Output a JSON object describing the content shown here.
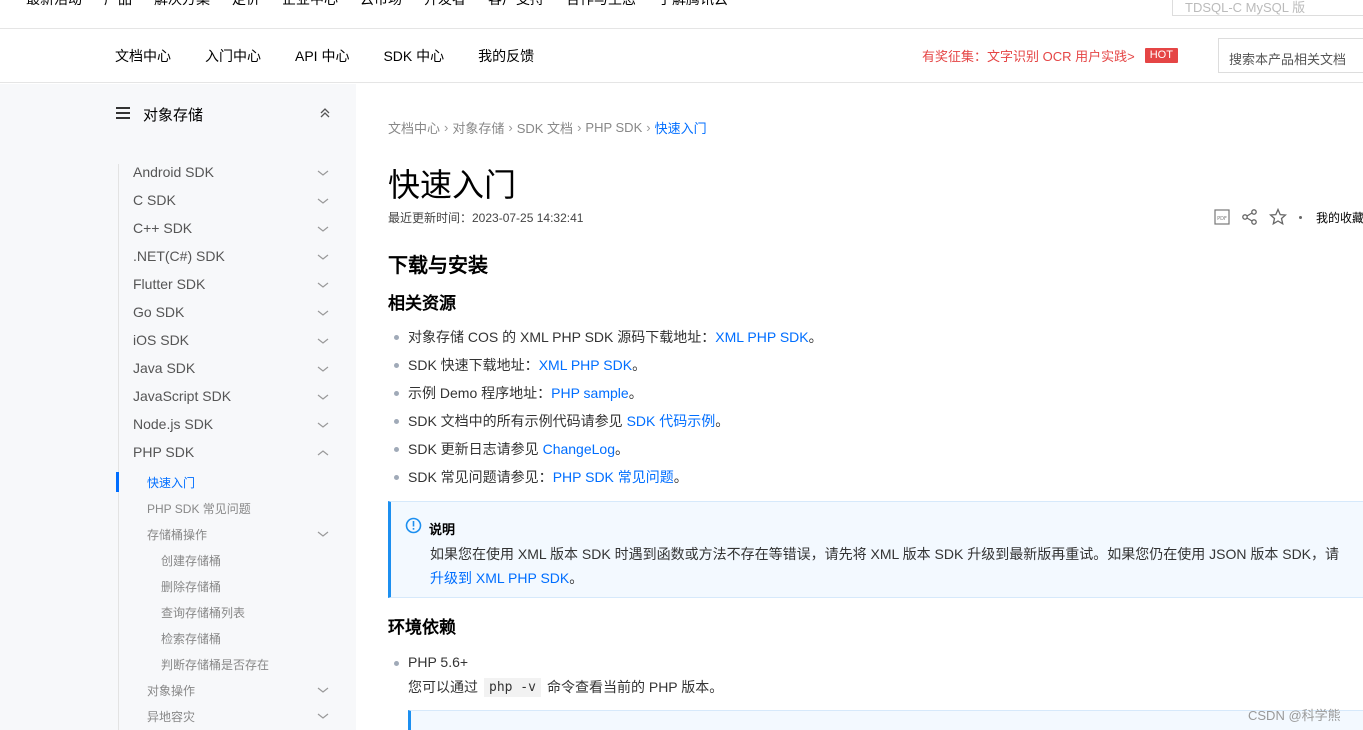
{
  "topnav": {
    "items": [
      "最新活动",
      "产品",
      "解决方案",
      "定价",
      "企业中心",
      "云市场",
      "开发者",
      "客户支持",
      "合作与生态",
      "了解腾讯云"
    ],
    "search_placeholder": "TDSQL-C MySQL 版"
  },
  "prodnav": {
    "tabs": [
      "文档中心",
      "入门中心",
      "API 中心",
      "SDK 中心",
      "我的反馈"
    ],
    "promo_text": "有奖征集：文字识别 OCR 用户实践>",
    "hot_badge": "HOT",
    "search_placeholder": "搜索本产品相关文档"
  },
  "sidebar": {
    "title": "对象存储",
    "sdk_items": [
      "Android SDK",
      "C SDK",
      "C++ SDK",
      ".NET(C#) SDK",
      "Flutter SDK",
      "Go SDK",
      "iOS SDK",
      "Java SDK",
      "JavaScript SDK",
      "Node.js SDK",
      "PHP SDK"
    ],
    "php_children": {
      "active": "快速入门",
      "faq": "PHP SDK 常见问题",
      "bucket_ops": "存储桶操作",
      "bucket_children": [
        "创建存储桶",
        "删除存储桶",
        "查询存储桶列表",
        "检索存储桶",
        "判断存储桶是否存在"
      ],
      "object_ops": "对象操作",
      "cross_region": "异地容灾"
    }
  },
  "main": {
    "breadcrumb": [
      "文档中心",
      "对象存储",
      "SDK 文档",
      "PHP SDK",
      "快速入门"
    ],
    "title": "快速入门",
    "updated": "最近更新时间：2023-07-25 14:32:41",
    "favorites_label": "我的收藏",
    "h_install": "下载与安装",
    "h_resources": "相关资源",
    "resources": [
      {
        "text": "对象存储 COS 的 XML PHP SDK 源码下载地址：",
        "link": "XML PHP SDK",
        "tail": "。"
      },
      {
        "text": "SDK 快速下载地址：",
        "link": "XML PHP SDK",
        "tail": "。"
      },
      {
        "text": "示例 Demo 程序地址：",
        "link": "PHP sample",
        "tail": "。"
      },
      {
        "text": "SDK 文档中的所有示例代码请参见 ",
        "link": "SDK 代码示例",
        "tail": "。"
      },
      {
        "text": "SDK 更新日志请参见 ",
        "link": "ChangeLog",
        "tail": "。"
      },
      {
        "text": "SDK 常见问题请参见：",
        "link": "PHP SDK 常见问题",
        "tail": "。"
      }
    ],
    "note": {
      "title": "说明",
      "text": "如果您在使用 XML 版本 SDK 时遇到函数或方法不存在等错误，请先将 XML 版本 SDK 升级到最新版再重试。如果您仍在使用 JSON 版本 SDK，请",
      "link": "升级到 XML PHP SDK",
      "tail": "。"
    },
    "h_env": "环境依赖",
    "env_item": "PHP 5.6+",
    "env_text_before": "您可以通过",
    "env_code": "php -v",
    "env_text_after": "命令查看当前的 PHP 版本。"
  },
  "watermark": "CSDN @科学熊",
  "colors": {
    "accent": "#006eff",
    "promo": "#e54545",
    "sidebar_bg": "#f7f8fa",
    "note_border": "#1c8ff0"
  }
}
